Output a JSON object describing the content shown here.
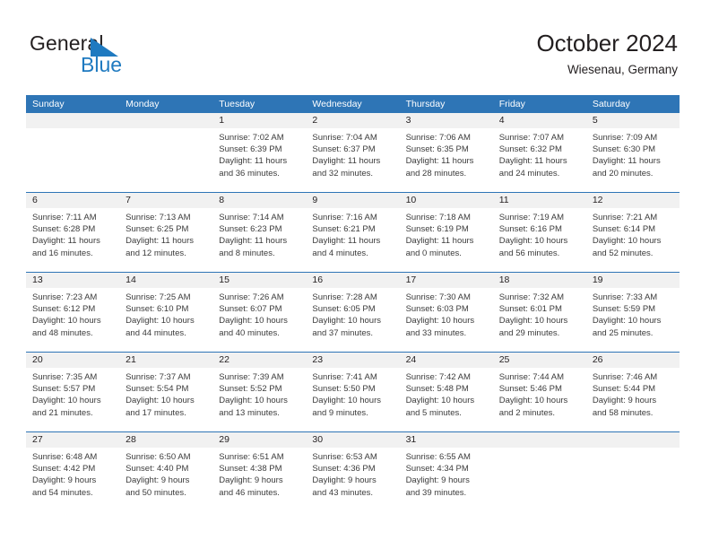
{
  "brand": {
    "name_part1": "General",
    "name_part2": "Blue",
    "flag_color": "#1f7ac0"
  },
  "header": {
    "title": "October 2024",
    "subtitle": "Wiesenau, Germany"
  },
  "theme": {
    "header_blue": "#2e75b6",
    "daynum_band": "#f1f1f1",
    "text": "#231f20",
    "body_text": "#3b3b3b"
  },
  "weekdays": [
    "Sunday",
    "Monday",
    "Tuesday",
    "Wednesday",
    "Thursday",
    "Friday",
    "Saturday"
  ],
  "weeks": [
    [
      {
        "day": "",
        "lines": []
      },
      {
        "day": "",
        "lines": []
      },
      {
        "day": "1",
        "lines": [
          "Sunrise: 7:02 AM",
          "Sunset: 6:39 PM",
          "Daylight: 11 hours",
          "and 36 minutes."
        ]
      },
      {
        "day": "2",
        "lines": [
          "Sunrise: 7:04 AM",
          "Sunset: 6:37 PM",
          "Daylight: 11 hours",
          "and 32 minutes."
        ]
      },
      {
        "day": "3",
        "lines": [
          "Sunrise: 7:06 AM",
          "Sunset: 6:35 PM",
          "Daylight: 11 hours",
          "and 28 minutes."
        ]
      },
      {
        "day": "4",
        "lines": [
          "Sunrise: 7:07 AM",
          "Sunset: 6:32 PM",
          "Daylight: 11 hours",
          "and 24 minutes."
        ]
      },
      {
        "day": "5",
        "lines": [
          "Sunrise: 7:09 AM",
          "Sunset: 6:30 PM",
          "Daylight: 11 hours",
          "and 20 minutes."
        ]
      }
    ],
    [
      {
        "day": "6",
        "lines": [
          "Sunrise: 7:11 AM",
          "Sunset: 6:28 PM",
          "Daylight: 11 hours",
          "and 16 minutes."
        ]
      },
      {
        "day": "7",
        "lines": [
          "Sunrise: 7:13 AM",
          "Sunset: 6:25 PM",
          "Daylight: 11 hours",
          "and 12 minutes."
        ]
      },
      {
        "day": "8",
        "lines": [
          "Sunrise: 7:14 AM",
          "Sunset: 6:23 PM",
          "Daylight: 11 hours",
          "and 8 minutes."
        ]
      },
      {
        "day": "9",
        "lines": [
          "Sunrise: 7:16 AM",
          "Sunset: 6:21 PM",
          "Daylight: 11 hours",
          "and 4 minutes."
        ]
      },
      {
        "day": "10",
        "lines": [
          "Sunrise: 7:18 AM",
          "Sunset: 6:19 PM",
          "Daylight: 11 hours",
          "and 0 minutes."
        ]
      },
      {
        "day": "11",
        "lines": [
          "Sunrise: 7:19 AM",
          "Sunset: 6:16 PM",
          "Daylight: 10 hours",
          "and 56 minutes."
        ]
      },
      {
        "day": "12",
        "lines": [
          "Sunrise: 7:21 AM",
          "Sunset: 6:14 PM",
          "Daylight: 10 hours",
          "and 52 minutes."
        ]
      }
    ],
    [
      {
        "day": "13",
        "lines": [
          "Sunrise: 7:23 AM",
          "Sunset: 6:12 PM",
          "Daylight: 10 hours",
          "and 48 minutes."
        ]
      },
      {
        "day": "14",
        "lines": [
          "Sunrise: 7:25 AM",
          "Sunset: 6:10 PM",
          "Daylight: 10 hours",
          "and 44 minutes."
        ]
      },
      {
        "day": "15",
        "lines": [
          "Sunrise: 7:26 AM",
          "Sunset: 6:07 PM",
          "Daylight: 10 hours",
          "and 40 minutes."
        ]
      },
      {
        "day": "16",
        "lines": [
          "Sunrise: 7:28 AM",
          "Sunset: 6:05 PM",
          "Daylight: 10 hours",
          "and 37 minutes."
        ]
      },
      {
        "day": "17",
        "lines": [
          "Sunrise: 7:30 AM",
          "Sunset: 6:03 PM",
          "Daylight: 10 hours",
          "and 33 minutes."
        ]
      },
      {
        "day": "18",
        "lines": [
          "Sunrise: 7:32 AM",
          "Sunset: 6:01 PM",
          "Daylight: 10 hours",
          "and 29 minutes."
        ]
      },
      {
        "day": "19",
        "lines": [
          "Sunrise: 7:33 AM",
          "Sunset: 5:59 PM",
          "Daylight: 10 hours",
          "and 25 minutes."
        ]
      }
    ],
    [
      {
        "day": "20",
        "lines": [
          "Sunrise: 7:35 AM",
          "Sunset: 5:57 PM",
          "Daylight: 10 hours",
          "and 21 minutes."
        ]
      },
      {
        "day": "21",
        "lines": [
          "Sunrise: 7:37 AM",
          "Sunset: 5:54 PM",
          "Daylight: 10 hours",
          "and 17 minutes."
        ]
      },
      {
        "day": "22",
        "lines": [
          "Sunrise: 7:39 AM",
          "Sunset: 5:52 PM",
          "Daylight: 10 hours",
          "and 13 minutes."
        ]
      },
      {
        "day": "23",
        "lines": [
          "Sunrise: 7:41 AM",
          "Sunset: 5:50 PM",
          "Daylight: 10 hours",
          "and 9 minutes."
        ]
      },
      {
        "day": "24",
        "lines": [
          "Sunrise: 7:42 AM",
          "Sunset: 5:48 PM",
          "Daylight: 10 hours",
          "and 5 minutes."
        ]
      },
      {
        "day": "25",
        "lines": [
          "Sunrise: 7:44 AM",
          "Sunset: 5:46 PM",
          "Daylight: 10 hours",
          "and 2 minutes."
        ]
      },
      {
        "day": "26",
        "lines": [
          "Sunrise: 7:46 AM",
          "Sunset: 5:44 PM",
          "Daylight: 9 hours",
          "and 58 minutes."
        ]
      }
    ],
    [
      {
        "day": "27",
        "lines": [
          "Sunrise: 6:48 AM",
          "Sunset: 4:42 PM",
          "Daylight: 9 hours",
          "and 54 minutes."
        ]
      },
      {
        "day": "28",
        "lines": [
          "Sunrise: 6:50 AM",
          "Sunset: 4:40 PM",
          "Daylight: 9 hours",
          "and 50 minutes."
        ]
      },
      {
        "day": "29",
        "lines": [
          "Sunrise: 6:51 AM",
          "Sunset: 4:38 PM",
          "Daylight: 9 hours",
          "and 46 minutes."
        ]
      },
      {
        "day": "30",
        "lines": [
          "Sunrise: 6:53 AM",
          "Sunset: 4:36 PM",
          "Daylight: 9 hours",
          "and 43 minutes."
        ]
      },
      {
        "day": "31",
        "lines": [
          "Sunrise: 6:55 AM",
          "Sunset: 4:34 PM",
          "Daylight: 9 hours",
          "and 39 minutes."
        ]
      },
      {
        "day": "",
        "lines": []
      },
      {
        "day": "",
        "lines": []
      }
    ]
  ]
}
